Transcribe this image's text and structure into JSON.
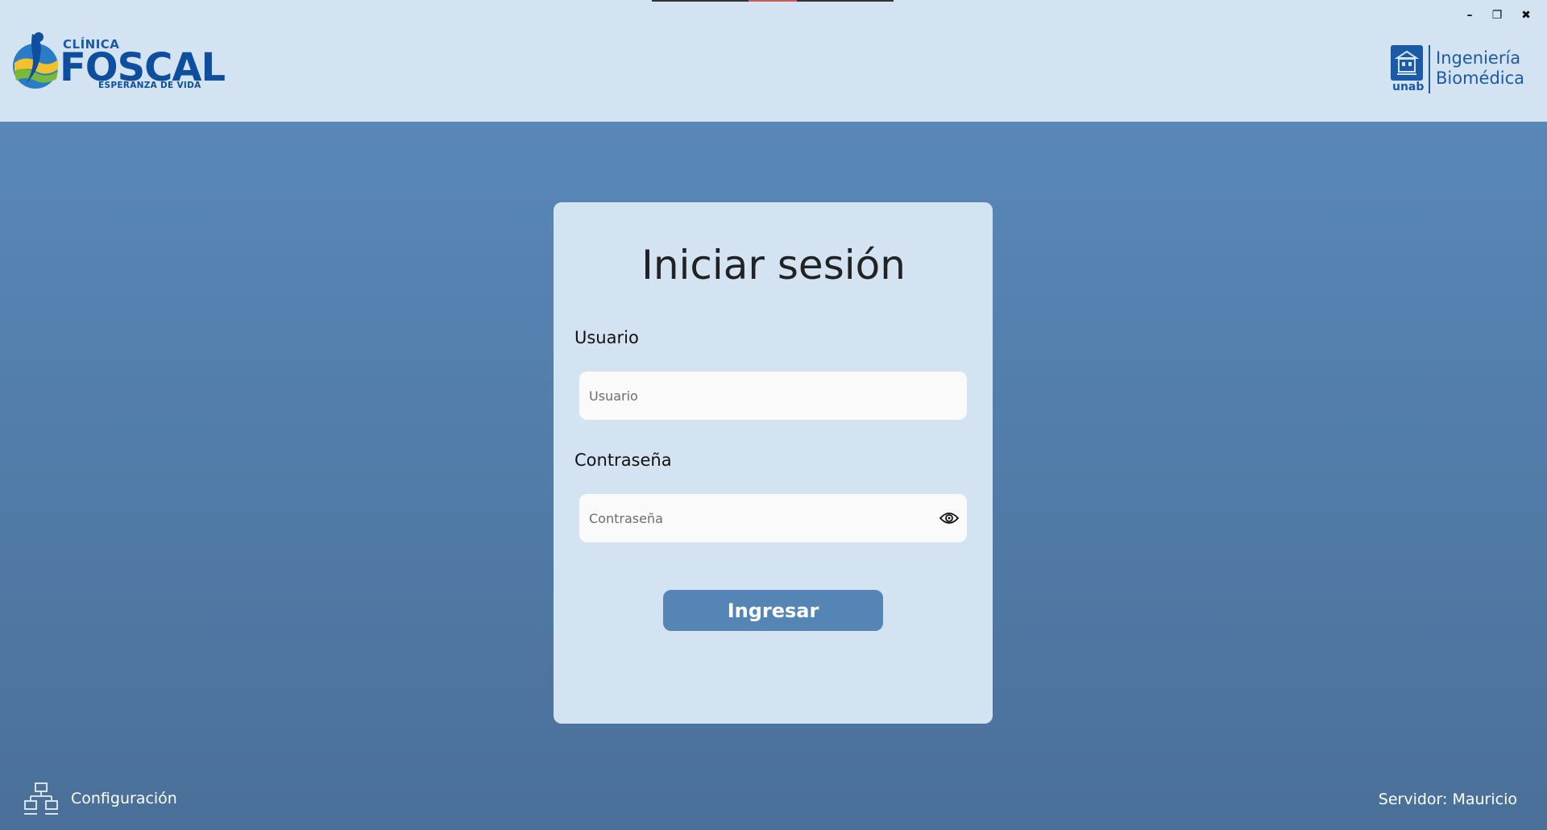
{
  "window_controls": {
    "minimize": "–",
    "restore": "❐",
    "close": "✖"
  },
  "header": {
    "left_logo": {
      "small_top": "CLÍNICA",
      "name": "FOSCAL",
      "tagline": "ESPERANZA DE VIDA"
    },
    "right_logo": {
      "brand": "unab",
      "line1": "Ingeniería",
      "line2": "Biomédica"
    }
  },
  "login": {
    "title": "Iniciar sesión",
    "username_label": "Usuario",
    "username_placeholder": "Usuario",
    "username_value": "",
    "password_label": "Contraseña",
    "password_placeholder": "Contraseña",
    "password_value": "",
    "submit_label": "Ingresar"
  },
  "footer": {
    "config_label": "Configuración",
    "server_text": "Servidor: Mauricio"
  },
  "icons": {
    "eye": "eye-icon",
    "network": "network-icon"
  },
  "colors": {
    "header_bg": "#d4e3f2",
    "card_bg": "#d4e3f2",
    "button_bg": "#5585b5",
    "brand_blue": "#0d4f9e"
  }
}
